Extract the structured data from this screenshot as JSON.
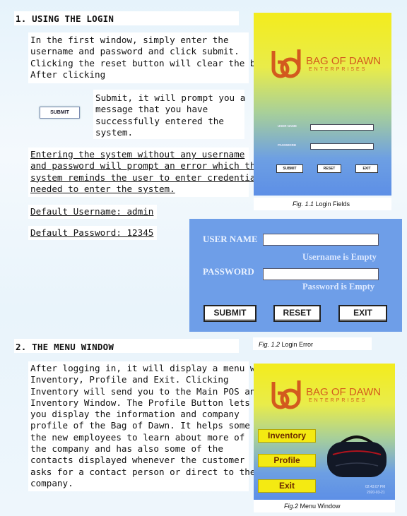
{
  "section1": {
    "heading": "1. USING THE LOGIN",
    "para1": [
      "In the first window, simply enter the",
      "username and password and click submit.",
      "Clicking the reset button will clear the boxes.",
      "After clicking"
    ],
    "inline_button": "SUBMIT",
    "para2": [
      "Submit, it will prompt you a",
      "message that you have",
      "successfully entered the",
      "system."
    ],
    "para3": [
      "Entering the system without any username",
      "and password will prompt an error which the",
      "system reminds the user to enter credentials",
      "needed to enter the system."
    ],
    "default_username": "Default Username: admin",
    "default_password": "Default Password: 12345"
  },
  "fig1": {
    "logo_line1": "BAG OF DAWN",
    "logo_line2": "ENTERPRISES",
    "username_label": "USER NAME",
    "password_label": "PASSWORD",
    "submit": "SUBMIT",
    "reset": "RESET",
    "exit": "EXIT",
    "caption_fig": "Fig. 1.1",
    "caption_text": "Login Fields"
  },
  "fig12": {
    "username_label": "USER NAME",
    "username_error": "Username is Empty",
    "password_label": "PASSWORD",
    "password_error": "Password is Empty",
    "submit": "SUBMIT",
    "reset": "RESET",
    "exit": "EXIT",
    "caption_fig": "Fig. 1.2",
    "caption_text": "Login Error"
  },
  "section2": {
    "heading": "2. THE MENU WINDOW",
    "para": [
      "After logging in, it will display a menu with",
      "Inventory, Profile and Exit. Clicking",
      "Inventory will send you to the Main POS and",
      "Inventory Window. The Profile Button lets",
      "you display the information and company",
      "profile of the Bag of Dawn. It helps some of",
      "the new employees to learn about more of",
      "the company and has also some of the",
      "contacts displayed whenever the customer",
      "asks for a contact person or direct to the",
      "company."
    ]
  },
  "fig2": {
    "logo_line1": "BAG OF DAWN",
    "logo_line2": "ENTERPRISES",
    "inventory": "Inventory",
    "profile": "Profile",
    "exit": "Exit",
    "time": "02:43:07 PM",
    "date": "2020-03-21",
    "caption_fig": "Fig.2",
    "caption_text": "Menu Window"
  },
  "colors": {
    "accent_yellow": "#f4ea12",
    "panel_blue": "#6e9ee8",
    "logo_orange": "#d35a1e"
  }
}
